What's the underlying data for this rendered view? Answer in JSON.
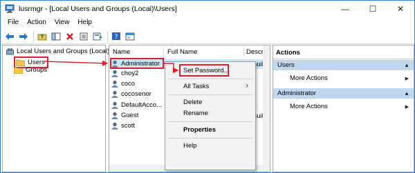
{
  "window": {
    "title": "lusrmgr - [Local Users and Groups (Local)\\Users]",
    "min_glyph": "—",
    "max_glyph": "☐",
    "close_glyph": "✕"
  },
  "menu": [
    "File",
    "Action",
    "View",
    "Help"
  ],
  "toolbar": {
    "icons": [
      "back-icon",
      "forward-icon",
      "up-folder-icon",
      "show-tree-icon",
      "delete-icon",
      "properties-icon",
      "export-icon",
      "help-icon",
      "console-icon"
    ]
  },
  "tree": {
    "root_label": "Local Users and Groups (Local)",
    "users_label": "Users",
    "groups_label": "Groups"
  },
  "list": {
    "columns": [
      "Name",
      "Full Name",
      "Descript"
    ],
    "users": [
      "Administrator",
      "choy2",
      "coco",
      "cocosenor",
      "DefaultAcco...",
      "Guest",
      "scott"
    ],
    "desc_admin": "Built-in",
    "desc_guest": "Built-in"
  },
  "actions": {
    "header": "Actions",
    "section1": "Users",
    "item1": "More Actions",
    "section2": "Administrator",
    "item2": "More Actions"
  },
  "context_menu": {
    "set_password": "Set Password...",
    "all_tasks": "All Tasks",
    "delete": "Delete",
    "rename": "Rename",
    "properties": "Properties",
    "help": "Help"
  },
  "colors": {
    "highlight": "#e01e2e",
    "selection": "#cce4f7",
    "actions_section": "#bfd8ef",
    "window_border": "#2b7fd4"
  }
}
